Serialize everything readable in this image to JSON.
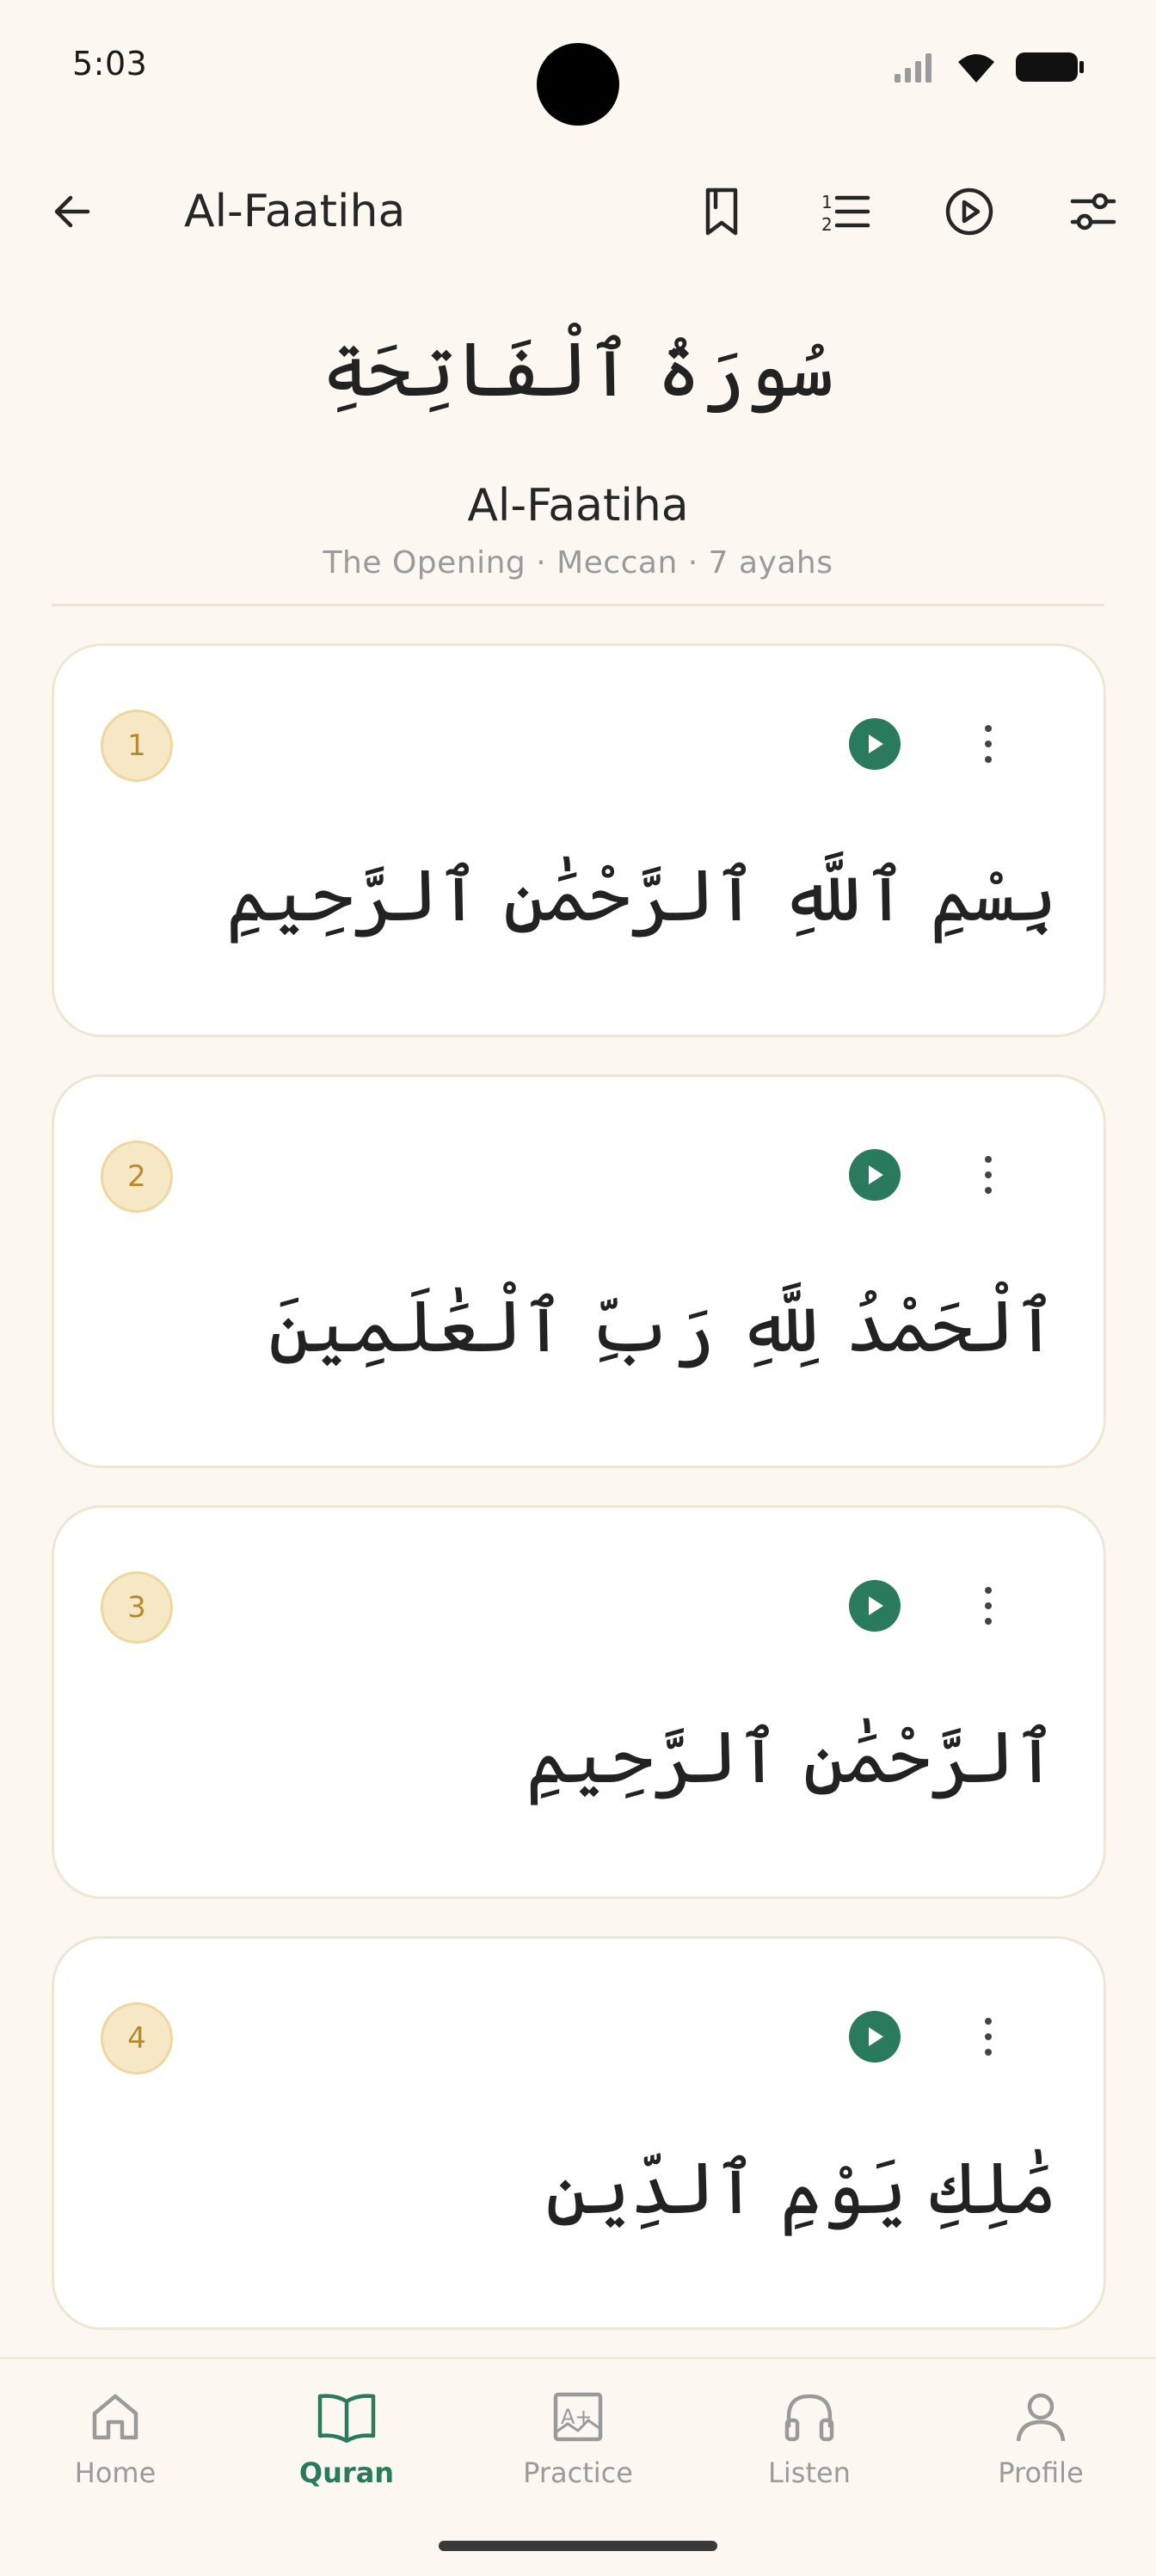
{
  "status_bar": {
    "time": "5:03"
  },
  "top_bar": {
    "title": "Al-Faatiha",
    "icons": [
      "back-arrow-icon",
      "bookmark-icon",
      "numbered-list-icon",
      "play-circle-icon",
      "sliders-icon"
    ]
  },
  "surah": {
    "arabic_name": "سُورَةُ ٱلْفَاتِحَةِ",
    "english_name": "Al-Faatiha",
    "meta": "The Opening · Meccan · 7 ayahs"
  },
  "ayahs": [
    {
      "number": "1",
      "arabic": "بِسْمِ ٱللَّهِ ٱلرَّحْمَٰنِ ٱلرَّحِيمِ"
    },
    {
      "number": "2",
      "arabic": "ٱلْحَمْدُ لِلَّهِ رَبِّ ٱلْعَٰلَمِينَ"
    },
    {
      "number": "3",
      "arabic": "ٱلرَّحْمَٰنِ ٱلرَّحِيمِ"
    },
    {
      "number": "4",
      "arabic": "مَٰلِكِ يَوْمِ ٱلدِّينِ"
    }
  ],
  "bottom_nav": {
    "active": "Quran",
    "items": [
      {
        "label": "Home",
        "icon": "home-icon"
      },
      {
        "label": "Quran",
        "icon": "open-book-icon"
      },
      {
        "label": "Practice",
        "icon": "grade-icon"
      },
      {
        "label": "Listen",
        "icon": "headphones-icon"
      },
      {
        "label": "Profile",
        "icon": "person-icon"
      }
    ]
  },
  "colors": {
    "background": "#fcf8f1",
    "card": "#ffffff",
    "accent_green": "#2a7a5d",
    "badge_fill": "#f6e8c4",
    "badge_text": "#b9892e",
    "muted_text": "#9a9a9a"
  }
}
